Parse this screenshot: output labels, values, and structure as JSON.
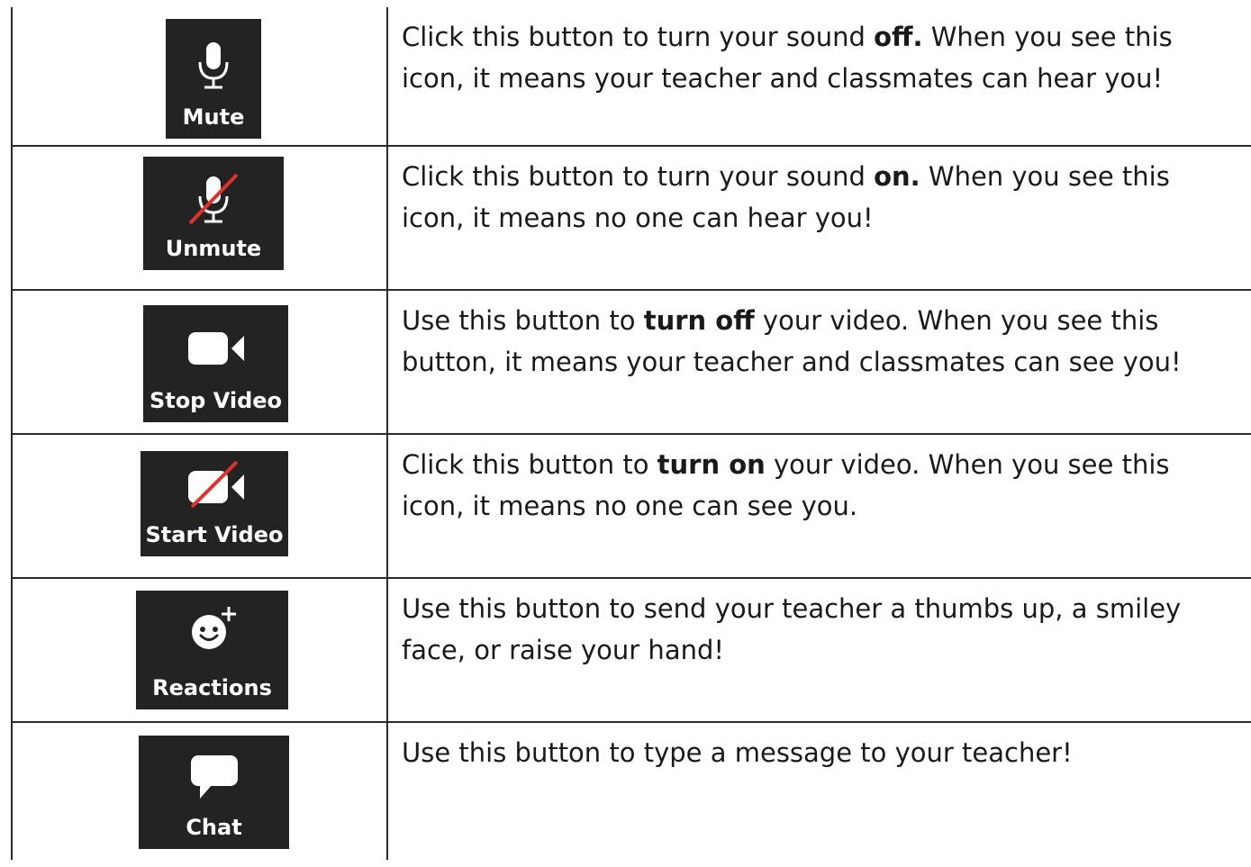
{
  "rows": [
    {
      "button_label": "Mute",
      "icon": "microphone-icon",
      "text_before": "Click this button to turn your sound ",
      "text_bold": "off.",
      "text_after": " When you see this icon, it means your teacher and classmates can hear you!"
    },
    {
      "button_label": "Unmute",
      "icon": "microphone-muted-icon",
      "text_before": "Click this button to turn your sound ",
      "text_bold": "on.",
      "text_after": " When you see this icon, it means no one can hear you!"
    },
    {
      "button_label": "Stop Video",
      "icon": "video-camera-icon",
      "text_before": "Use this button to ",
      "text_bold": "turn off",
      "text_after": " your video. When you see this button, it means your teacher and classmates can see you!"
    },
    {
      "button_label": "Start Video",
      "icon": "video-camera-off-icon",
      "text_before": "Click this button to ",
      "text_bold": "turn on",
      "text_after": " your video. When you see this icon, it means no one can see you."
    },
    {
      "button_label": "Reactions",
      "icon": "smiley-plus-icon",
      "text_before": "Use this button to send your teacher a thumbs up, a smiley face, or raise your hand!",
      "text_bold": "",
      "text_after": ""
    },
    {
      "button_label": "Chat",
      "icon": "chat-bubble-icon",
      "text_before": "Use this button to type a message to your teacher!",
      "text_bold": "",
      "text_after": ""
    }
  ],
  "colors": {
    "button_bg": "#232323",
    "button_text": "#ffffff",
    "muted_slash": "#e0312b",
    "grid_line": "#2b2b2b"
  }
}
